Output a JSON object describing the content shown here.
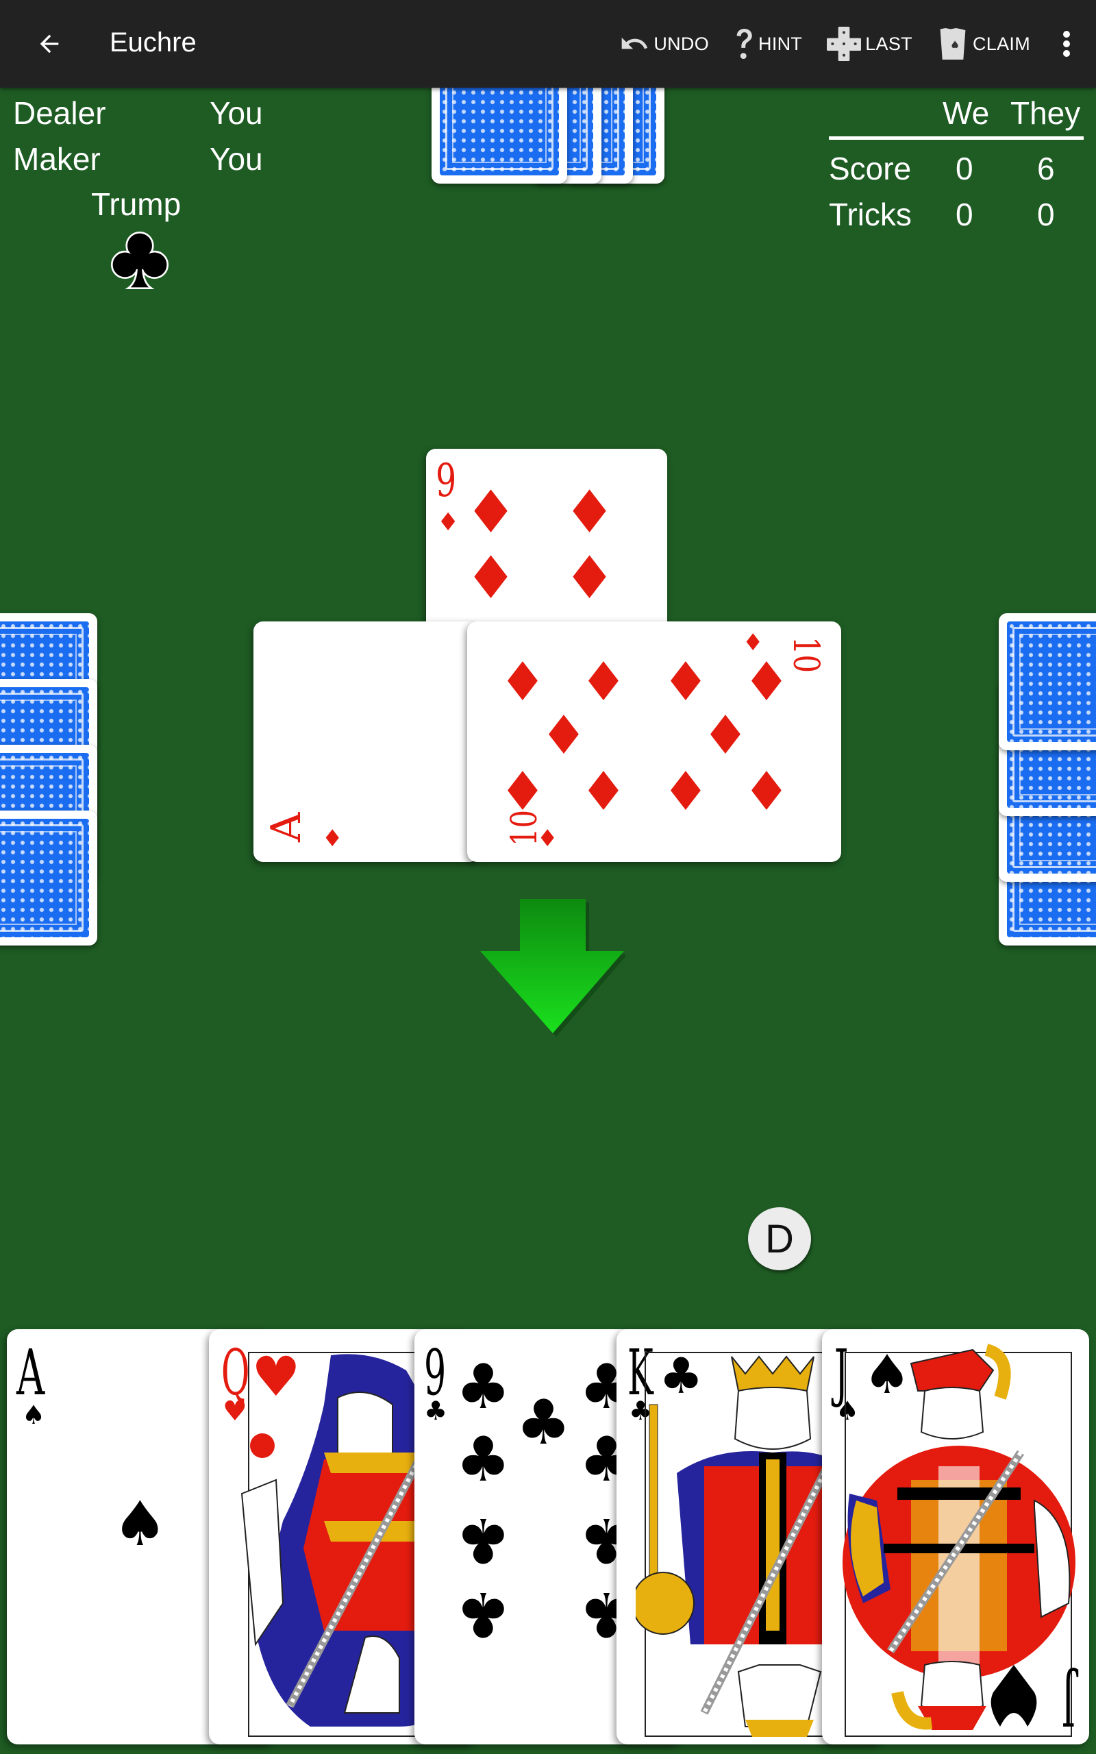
{
  "appbar": {
    "title": "Euchre",
    "actions": [
      {
        "id": "undo",
        "label": "UNDO",
        "icon": "undo-icon"
      },
      {
        "id": "hint",
        "label": "HINT",
        "icon": "question-icon"
      },
      {
        "id": "last",
        "label": "LAST",
        "icon": "last-trick-icon"
      },
      {
        "id": "claim",
        "label": "CLAIM",
        "icon": "claim-cards-icon"
      }
    ],
    "overflow_icon": "more-vert-icon",
    "back_icon": "arrow-back-icon"
  },
  "info": {
    "dealer_label": "Dealer",
    "dealer_value": "You",
    "maker_label": "Maker",
    "maker_value": "You",
    "trump_label": "Trump",
    "trump_suit": "clubs",
    "trump_symbol": "♣"
  },
  "scoreboard": {
    "col_we": "We",
    "col_they": "They",
    "rows": [
      {
        "label": "Score",
        "we": "0",
        "they": "6"
      },
      {
        "label": "Tricks",
        "we": "0",
        "they": "0"
      }
    ]
  },
  "opponents": {
    "north_cards": 4,
    "west_cards": 4,
    "east_cards": 4
  },
  "trick": {
    "cards": [
      {
        "player": "north",
        "rank": "9",
        "suit": "♦",
        "color": "red"
      },
      {
        "player": "west",
        "rank": "A",
        "suit": "♦",
        "color": "red"
      },
      {
        "player": "east",
        "rank": "10",
        "suit": "♦",
        "color": "red"
      }
    ],
    "turn_indicator": "down-arrow-icon"
  },
  "dealer_chip": "D",
  "hand": [
    {
      "rank": "A",
      "suit": "♠",
      "color": "black",
      "name": "ace-of-spades"
    },
    {
      "rank": "Q",
      "suit": "♥",
      "color": "red",
      "name": "queen-of-hearts"
    },
    {
      "rank": "9",
      "suit": "♣",
      "color": "black",
      "name": "nine-of-clubs"
    },
    {
      "rank": "K",
      "suit": "♣",
      "color": "black",
      "name": "king-of-clubs"
    },
    {
      "rank": "J",
      "suit": "♠",
      "color": "black",
      "name": "jack-of-spades"
    }
  ],
  "colors": {
    "felt": "#1e5c23",
    "appbar": "#222222",
    "card_back": "#1a6cf0",
    "red_suit": "#e41b0f",
    "arrow_green": "#11c414"
  }
}
